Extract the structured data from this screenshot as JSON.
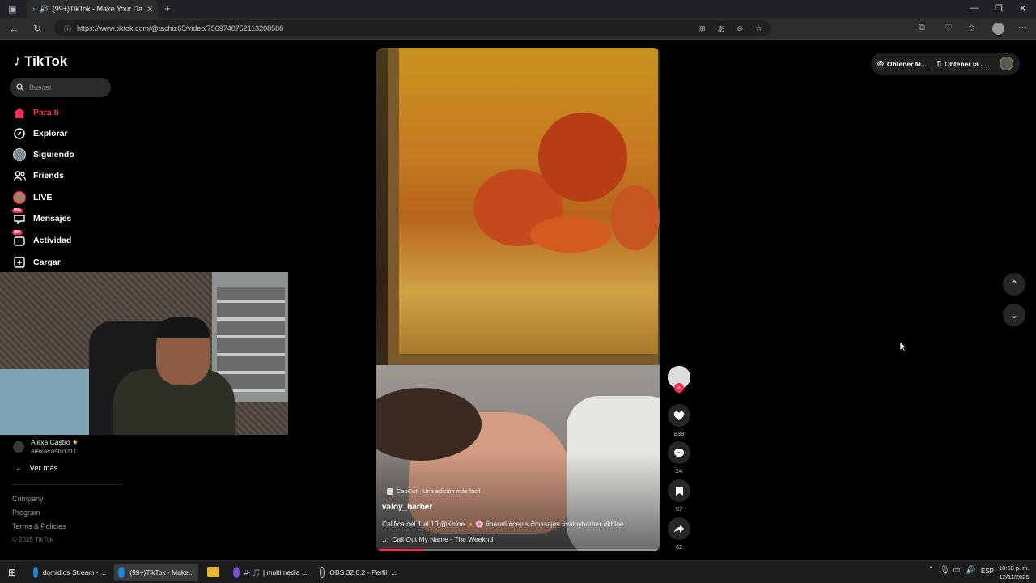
{
  "browser": {
    "tab_title": "(99+)TikTok - Make Your Day",
    "url": "https://www.tiktok.com/@tachiz65/video/7569740752113208588"
  },
  "tiktok": {
    "logo": "TikTok",
    "search_placeholder": "Buscar",
    "nav": [
      "Para ti",
      "Explorar",
      "Siguiendo",
      "Friends",
      "LIVE",
      "Mensajes",
      "Actividad",
      "Cargar"
    ],
    "badge": "99+",
    "following_name": "Alexa Castro",
    "following_handle": "alexacastro211",
    "ver_mas": "Ver más",
    "footer_links": [
      "Company",
      "Program",
      "Terms & Policies"
    ],
    "copyright": "© 2025 TikTok",
    "top_right": {
      "get_app_1": "Obtener M...",
      "get_app_2": "Obtener la ..."
    }
  },
  "video": {
    "capcut_label": "CapCut · Una edición más fácil",
    "author": "valoy_barber",
    "description": "Califica del 1 al 10 @Khloe 🧸🌸 #parati #cejas #masajes #valoybarber #khloe",
    "music": "Call Out My Name - The Weeknd",
    "progress": 0.17,
    "likes": "839",
    "comments": "24",
    "saves": "57",
    "shares": "62"
  },
  "taskbar": {
    "items": [
      "domidios Stream - ...",
      "(99+)TikTok - Make...",
      "#· 🎵 | multimedia ...",
      "OBS 32.0.2 - Perfil: ..."
    ],
    "lang": "ESP",
    "time": "10:58 p. m.",
    "date": "12/11/2025"
  },
  "colors": {
    "accent": "#fe2c55",
    "bg": "#000000"
  }
}
